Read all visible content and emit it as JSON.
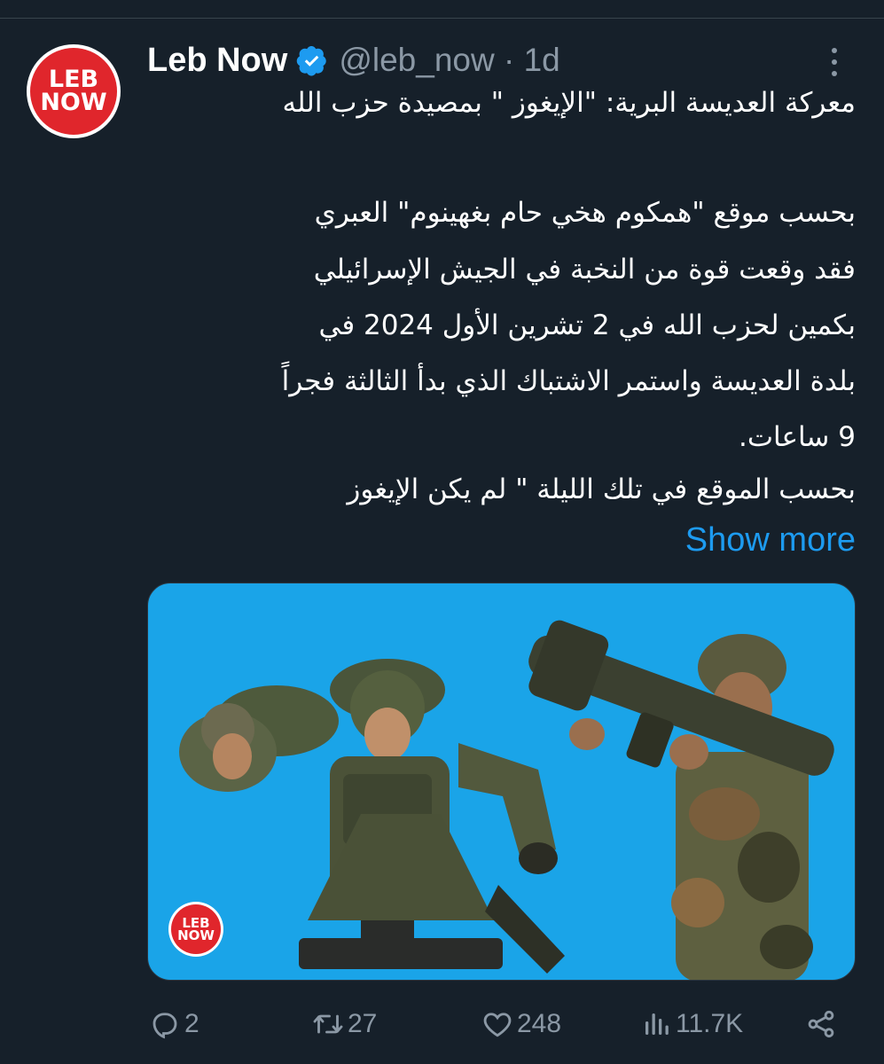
{
  "tweet": {
    "avatar_text": [
      "LEB",
      "NOW"
    ],
    "display_name": "Leb Now",
    "handle_time": "@leb_now · 1d",
    "text_lines": [
      "معركة العديسة البرية: \"الإيغوز \" بمصيدة حزب الله",
      "بحسب موقع \"همكوم هخي حام بغهينوم\" العبري",
      "فقد وقعت قوة من النخبة في الجيش الإسرائيلي",
      "بكمين لحزب الله في 2 تشرين الأول 2024 في",
      "بلدة العديسة واستمر الاشتباك الذي بدأ الثالثة فجراً",
      "9 ساعات.",
      "بحسب الموقع في تلك الليلة \" لم يكن الإيغوز"
    ],
    "show_more": "Show more",
    "media_logo_text": [
      "LEB",
      "NOW"
    ]
  },
  "actions": {
    "replies": "2",
    "retweets": "27",
    "likes": "248",
    "views": "11.7K"
  },
  "colors": {
    "background": "#16202a",
    "accent": "#1d9bf0",
    "muted": "#8b98a5",
    "media_bg": "#1aa4e8",
    "brand_red": "#e0262c"
  },
  "icons": [
    "verified-badge-icon",
    "more-options-icon",
    "reply-icon",
    "retweet-icon",
    "like-icon",
    "views-icon",
    "share-icon"
  ]
}
